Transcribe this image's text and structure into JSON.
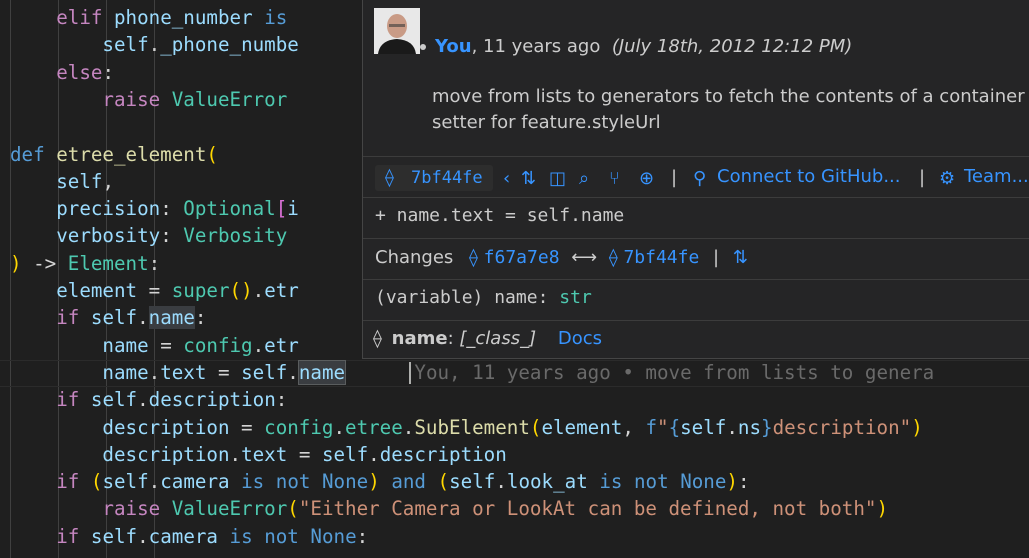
{
  "code": {
    "lines": [
      {
        "indent": "    ",
        "parts": [
          [
            "ctl",
            "elif"
          ],
          [
            "pn",
            " "
          ],
          [
            "var",
            "phone_number"
          ],
          [
            "pn",
            " "
          ],
          [
            "kw",
            "is"
          ]
        ]
      },
      {
        "indent": "        ",
        "parts": [
          [
            "var",
            "self"
          ],
          [
            "pn",
            "."
          ],
          [
            "var",
            "_phone_numbe"
          ]
        ]
      },
      {
        "indent": "    ",
        "parts": [
          [
            "ctl",
            "else"
          ],
          [
            "pn",
            ":"
          ]
        ]
      },
      {
        "indent": "        ",
        "parts": [
          [
            "ctl",
            "raise"
          ],
          [
            "pn",
            " "
          ],
          [
            "ty",
            "ValueError"
          ]
        ]
      },
      {
        "indent": "",
        "parts": []
      },
      {
        "indent": "",
        "parts": [
          [
            "kw",
            "def"
          ],
          [
            "pn",
            " "
          ],
          [
            "fn",
            "etree_element"
          ],
          [
            "br",
            "("
          ]
        ]
      },
      {
        "indent": "    ",
        "parts": [
          [
            "var",
            "self"
          ],
          [
            "pn",
            ","
          ]
        ]
      },
      {
        "indent": "    ",
        "parts": [
          [
            "var",
            "precision"
          ],
          [
            "pn",
            ": "
          ],
          [
            "ty",
            "Optional"
          ],
          [
            "br2",
            "["
          ],
          [
            "var",
            "i"
          ]
        ]
      },
      {
        "indent": "    ",
        "parts": [
          [
            "var",
            "verbosity"
          ],
          [
            "pn",
            ": "
          ],
          [
            "ty",
            "Verbosity"
          ]
        ]
      },
      {
        "indent": "",
        "parts": [
          [
            "br",
            ")"
          ],
          [
            "pn",
            " -> "
          ],
          [
            "ty",
            "Element"
          ],
          [
            "pn",
            ":"
          ]
        ]
      },
      {
        "indent": "    ",
        "parts": [
          [
            "var",
            "element"
          ],
          [
            "pn",
            " = "
          ],
          [
            "ty",
            "super"
          ],
          [
            "br",
            "("
          ],
          [
            "br",
            ")"
          ],
          [
            "pn",
            "."
          ],
          [
            "var",
            "etr"
          ]
        ]
      },
      {
        "indent": "    ",
        "parts": [
          [
            "ctl",
            "if"
          ],
          [
            "pn",
            " "
          ],
          [
            "var",
            "self"
          ],
          [
            "pn",
            "."
          ],
          [
            "var hl",
            "name"
          ],
          [
            "pn",
            ":"
          ]
        ]
      },
      {
        "indent": "        ",
        "parts": [
          [
            "var",
            "name"
          ],
          [
            "pn",
            " = "
          ],
          [
            "ty",
            "config"
          ],
          [
            "pn",
            "."
          ],
          [
            "var",
            "etr"
          ]
        ]
      },
      {
        "indent": "        ",
        "parts": [
          [
            "var",
            "name"
          ],
          [
            "pn",
            "."
          ],
          [
            "var",
            "text"
          ],
          [
            "pn",
            " = "
          ],
          [
            "var",
            "self"
          ],
          [
            "pn",
            "."
          ],
          [
            "var hlb",
            "name"
          ],
          [
            "ghost",
            "      You, 11 years ago • move from lists to genera"
          ]
        ]
      },
      {
        "indent": "    ",
        "parts": [
          [
            "ctl",
            "if"
          ],
          [
            "pn",
            " "
          ],
          [
            "var",
            "self"
          ],
          [
            "pn",
            "."
          ],
          [
            "var",
            "description"
          ],
          [
            "pn",
            ":"
          ]
        ]
      },
      {
        "indent": "        ",
        "parts": [
          [
            "var",
            "description"
          ],
          [
            "pn",
            " = "
          ],
          [
            "ty",
            "config"
          ],
          [
            "pn",
            "."
          ],
          [
            "ty",
            "etree"
          ],
          [
            "pn",
            "."
          ],
          [
            "fn",
            "SubElement"
          ],
          [
            "br",
            "("
          ],
          [
            "var",
            "element"
          ],
          [
            "pn",
            ", "
          ],
          [
            "kw",
            "f"
          ],
          [
            "str",
            "\""
          ],
          [
            "kw",
            "{"
          ],
          [
            "var",
            "self"
          ],
          [
            "pn",
            "."
          ],
          [
            "var",
            "ns"
          ],
          [
            "kw",
            "}"
          ],
          [
            "str",
            "description\""
          ],
          [
            "br",
            ")"
          ]
        ]
      },
      {
        "indent": "        ",
        "parts": [
          [
            "var",
            "description"
          ],
          [
            "pn",
            "."
          ],
          [
            "var",
            "text"
          ],
          [
            "pn",
            " = "
          ],
          [
            "var",
            "self"
          ],
          [
            "pn",
            "."
          ],
          [
            "var",
            "description"
          ]
        ]
      },
      {
        "indent": "    ",
        "parts": [
          [
            "ctl",
            "if"
          ],
          [
            "pn",
            " "
          ],
          [
            "br",
            "("
          ],
          [
            "var",
            "self"
          ],
          [
            "pn",
            "."
          ],
          [
            "var",
            "camera"
          ],
          [
            "pn",
            " "
          ],
          [
            "kw",
            "is not"
          ],
          [
            "pn",
            " "
          ],
          [
            "kw",
            "None"
          ],
          [
            "br",
            ")"
          ],
          [
            "pn",
            " "
          ],
          [
            "kw",
            "and"
          ],
          [
            "pn",
            " "
          ],
          [
            "br",
            "("
          ],
          [
            "var",
            "self"
          ],
          [
            "pn",
            "."
          ],
          [
            "var",
            "look_at"
          ],
          [
            "pn",
            " "
          ],
          [
            "kw",
            "is not"
          ],
          [
            "pn",
            " "
          ],
          [
            "kw",
            "None"
          ],
          [
            "br",
            ")"
          ],
          [
            "pn",
            ":"
          ]
        ]
      },
      {
        "indent": "        ",
        "parts": [
          [
            "ctl",
            "raise"
          ],
          [
            "pn",
            " "
          ],
          [
            "ty",
            "ValueError"
          ],
          [
            "br",
            "("
          ],
          [
            "str",
            "\"Either Camera or LookAt can be defined, not both\""
          ],
          [
            "br",
            ")"
          ]
        ]
      },
      {
        "indent": "    ",
        "parts": [
          [
            "ctl",
            "if"
          ],
          [
            "pn",
            " "
          ],
          [
            "var",
            "self"
          ],
          [
            "pn",
            "."
          ],
          [
            "var",
            "camera"
          ],
          [
            "pn",
            " "
          ],
          [
            "kw",
            "is not"
          ],
          [
            "pn",
            " "
          ],
          [
            "kw",
            "None"
          ],
          [
            "pn",
            ":"
          ]
        ]
      }
    ]
  },
  "hover": {
    "author": "You",
    "relative_time": ", 11 years ago",
    "date": "(July 18th, 2012 12:12 PM)",
    "message_line1": "move from lists to generators to fetch the contents of a container",
    "message_line2": "setter for feature.styleUrl",
    "commit_sha": "7bf44fe",
    "connect_label": "Connect to GitHub...",
    "team_label": "Team...",
    "diff_line": "+ name.text = self.name",
    "changes_label": "Changes",
    "from_sha": "f67a7e8",
    "to_sha": "7bf44fe",
    "variable_line": "(variable) name: str",
    "symbol_name": "name",
    "symbol_type": "[_class_]",
    "docs_label": "Docs"
  },
  "colors": {
    "background": "#1f1f1f",
    "hover_bg": "#252526",
    "link": "#3794ff"
  }
}
